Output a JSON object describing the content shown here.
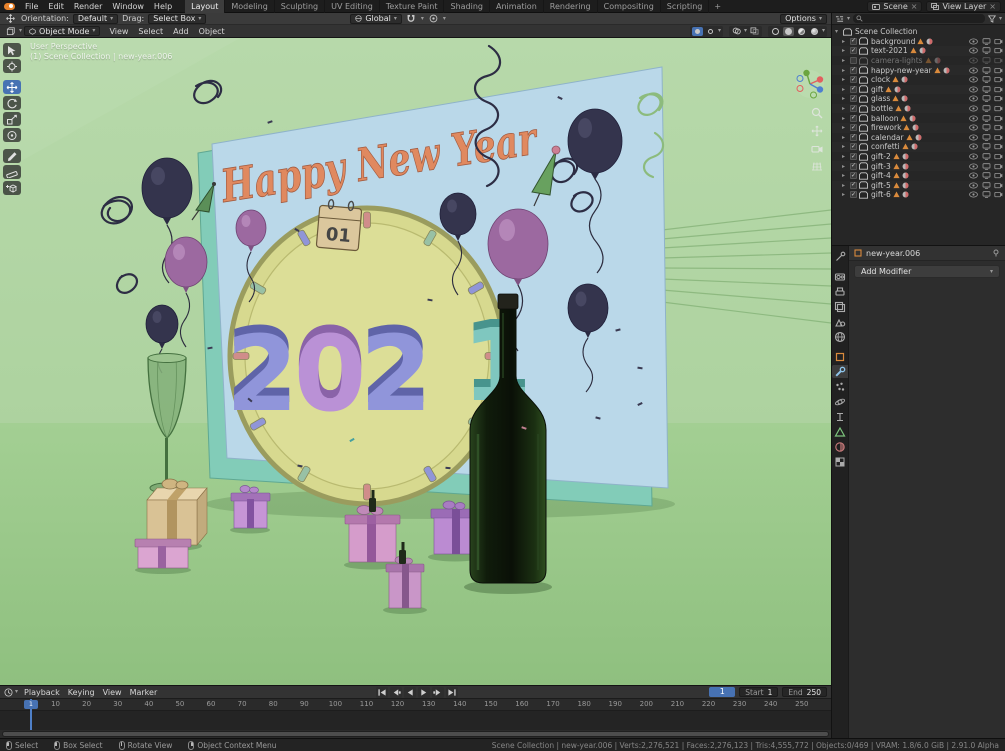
{
  "icons": {
    "chevron": "▾",
    "disclosure": "▸",
    "disclosure_open": "▾",
    "close": "×",
    "plus": "+",
    "check": "✓"
  },
  "colors": {
    "accent": "#4772b3",
    "object_orange": "#d98a3c",
    "viewport_bg": "#aed3a0",
    "card_blue": "#bad8e9",
    "card_teal": "#82ccb8",
    "clock_face": "#d7d98f",
    "banner_text_color": "#e0895f"
  },
  "topbar": {
    "menus": [
      "File",
      "Edit",
      "Render",
      "Window",
      "Help"
    ],
    "workspaces": [
      {
        "label": "Layout",
        "active": true
      },
      {
        "label": "Modeling"
      },
      {
        "label": "Sculpting"
      },
      {
        "label": "UV Editing"
      },
      {
        "label": "Texture Paint"
      },
      {
        "label": "Shading"
      },
      {
        "label": "Animation"
      },
      {
        "label": "Rendering"
      },
      {
        "label": "Compositing"
      },
      {
        "label": "Scripting"
      }
    ],
    "workspace_add": "+",
    "scene_field": "Scene",
    "view_layer_field": "View Layer"
  },
  "tool_settings": {
    "orientation_label": "Orientation:",
    "orientation_value": "Default",
    "drag_label": "Drag:",
    "drag_value": "Select Box",
    "transform_orientation": "Global",
    "options_label": "Options"
  },
  "viewport_header": {
    "mode": "Object Mode",
    "menus": [
      "View",
      "Select",
      "Add",
      "Object"
    ]
  },
  "viewport": {
    "overlay_line1": "User Perspective",
    "overlay_line2": "(1) Scene Collection | new-year.006",
    "tools": [
      "select-box",
      "cursor",
      "move",
      "rotate",
      "scale",
      "transform",
      "annotate",
      "measure",
      "add-cube"
    ],
    "active_tool": "move",
    "scene": {
      "banner_text": "Happy New Year",
      "year_digits": [
        "2",
        "0",
        "2",
        "1"
      ],
      "calendar_day": "01"
    }
  },
  "outliner": {
    "root_label": "Scene Collection",
    "items": [
      {
        "label": "background"
      },
      {
        "label": "text-2021"
      },
      {
        "label": "camera-lights",
        "muted": true
      },
      {
        "label": "happy-new-year"
      },
      {
        "label": "clock"
      },
      {
        "label": "gift"
      },
      {
        "label": "glass"
      },
      {
        "label": "bottle"
      },
      {
        "label": "balloon"
      },
      {
        "label": "firework"
      },
      {
        "label": "calendar"
      },
      {
        "label": "confetti"
      },
      {
        "label": "gift-2"
      },
      {
        "label": "gift-3"
      },
      {
        "label": "gift-4"
      },
      {
        "label": "gift-5"
      },
      {
        "label": "gift-6"
      }
    ]
  },
  "properties": {
    "tabs": [
      "tool",
      "render",
      "output",
      "view-layer",
      "scene",
      "world",
      "object",
      "modifiers",
      "particles",
      "physics",
      "constraints",
      "object-data",
      "material",
      "texture"
    ],
    "active_tab": "modifiers",
    "breadcrumb_object": "new-year.006",
    "add_modifier_label": "Add Modifier"
  },
  "timeline": {
    "menus": [
      "Playback",
      "Keying",
      "View",
      "Marker"
    ],
    "playback_buttons": [
      "jump-to-start",
      "previous-keyframe",
      "play-reverse",
      "play",
      "next-keyframe",
      "jump-to-end"
    ],
    "current_frame": "1",
    "start_label": "Start",
    "start_value": "1",
    "end_label": "End",
    "end_value": "250",
    "ruler_ticks": [
      "10",
      "20",
      "30",
      "40",
      "50",
      "60",
      "70",
      "80",
      "90",
      "100",
      "110",
      "120",
      "130",
      "140",
      "150",
      "160",
      "170",
      "180",
      "190",
      "200",
      "210",
      "220",
      "230",
      "240",
      "250"
    ]
  },
  "statusbar": {
    "hints": [
      {
        "label": "Select",
        "button": "left"
      },
      {
        "label": "Box Select",
        "button": "left"
      },
      {
        "label": "Rotate View",
        "button": "middle"
      },
      {
        "label": "Object Context Menu",
        "button": "right"
      }
    ],
    "stats": "Scene Collection | new-year.006 | Verts:2,276,521 | Faces:2,276,123 | Tris:4,555,772 | Objects:0/469 | VRAM: 1.8/6.0 GiB | 2.91.0 Alpha"
  }
}
